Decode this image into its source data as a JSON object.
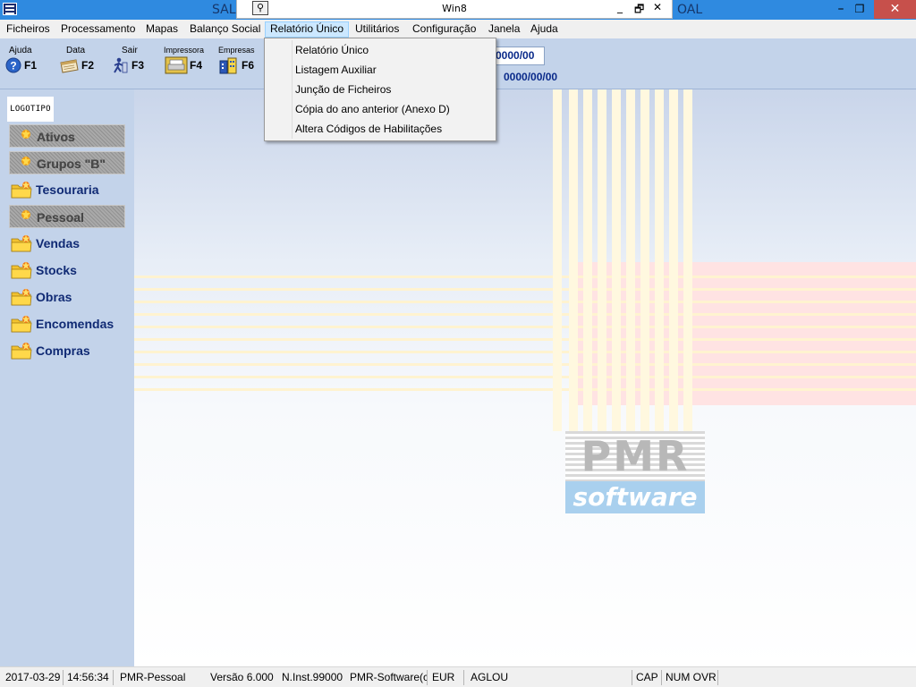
{
  "titlebar": {
    "left_fragment": "SAL",
    "right_fragment": "OAL",
    "minimize": "–",
    "restore": "❐",
    "close": "✕"
  },
  "inner_window": {
    "title": "Win8",
    "minimize": "_",
    "restore": "🗗",
    "close": "✕"
  },
  "menubar": {
    "items": [
      "Ficheiros",
      "Processamento",
      "Mapas",
      "Balanço Social",
      "Relatório Único",
      "Utilitários",
      "Configuração",
      "Janela",
      "Ajuda"
    ]
  },
  "dropdown": {
    "items": [
      "Relatório Único",
      "Listagem Auxiliar",
      "Junção de Ficheiros",
      "Cópia do ano anterior (Anexo D)",
      "Altera Códigos de Habilitações"
    ]
  },
  "toolbar": {
    "buttons": [
      {
        "caption": "Ajuda",
        "key": "F1",
        "icon": "help-icon"
      },
      {
        "caption": "Data",
        "key": "F2",
        "icon": "calendar-icon"
      },
      {
        "caption": "Sair",
        "key": "F3",
        "icon": "exit-icon"
      },
      {
        "caption": "Impressora",
        "key": "F4",
        "icon": "printer-icon"
      },
      {
        "caption": "Empresas",
        "key": "F6",
        "icon": "companies-icon"
      }
    ],
    "date_box": "0000/00",
    "date_text": "0000/00/00"
  },
  "sidebar": {
    "logo": "LOGOTIPO",
    "items": [
      {
        "label": "Ativos",
        "enabled": false
      },
      {
        "label": "Grupos \"B\"",
        "enabled": false
      },
      {
        "label": "Tesouraria",
        "enabled": true
      },
      {
        "label": "Pessoal",
        "enabled": false
      },
      {
        "label": "Vendas",
        "enabled": true
      },
      {
        "label": "Stocks",
        "enabled": true
      },
      {
        "label": "Obras",
        "enabled": true
      },
      {
        "label": "Encomendas",
        "enabled": true
      },
      {
        "label": "Compras",
        "enabled": true
      }
    ]
  },
  "main": {
    "logo_top": "PMR",
    "logo_bottom": "software"
  },
  "statusbar": {
    "date": "2017-03-29",
    "time": "14:56:34",
    "app": "PMR-Pessoal",
    "version": "Versão  6.000",
    "install": "N.Inst.99000",
    "company": "PMR-Software(c",
    "currency": "EUR",
    "user": "AGLOU",
    "cap": "CAP",
    "num_ovr": "NUM OVR"
  },
  "colors": {
    "titlebar": "#2f8ae0",
    "toolbar": "#c3d3ea",
    "menu_highlight": "#cce8ff",
    "sidebar_label": "#102a74",
    "date_text": "#0a2a8a"
  }
}
